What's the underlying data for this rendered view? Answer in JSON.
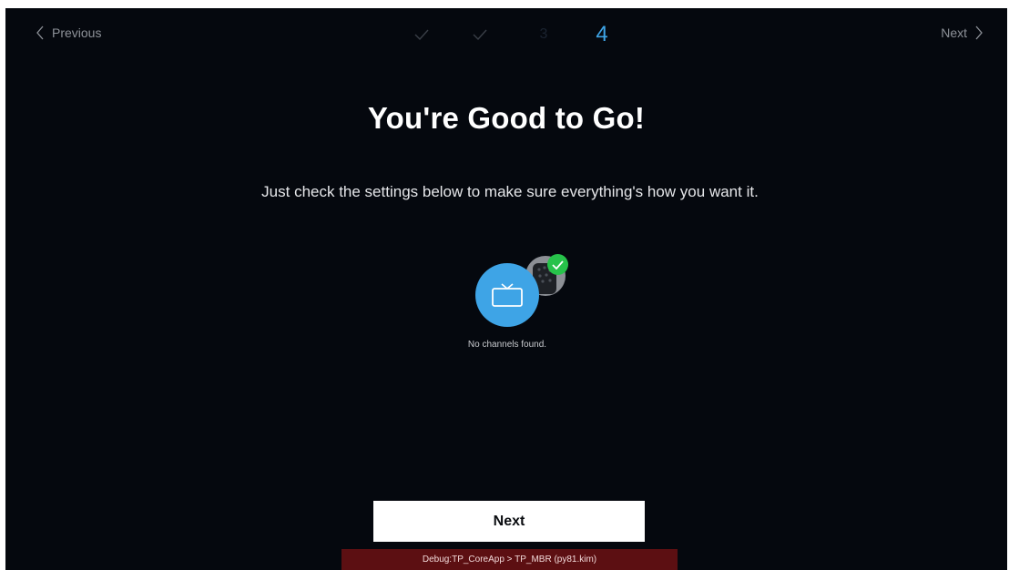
{
  "nav": {
    "previous_label": "Previous",
    "next_label": "Next"
  },
  "stepper": {
    "steps": [
      {
        "state": "completed",
        "label": ""
      },
      {
        "state": "completed",
        "label": ""
      },
      {
        "state": "upcoming",
        "label": "3"
      },
      {
        "state": "current",
        "label": "4"
      }
    ]
  },
  "main": {
    "title": "You're Good to Go!",
    "subtitle": "Just check the settings below to make sure everything's how you want it.",
    "status_text": "No channels found.",
    "icons": [
      "tv-icon",
      "remote-icon",
      "checkmark-icon"
    ]
  },
  "footer": {
    "next_button_label": "Next",
    "debug_text": "Debug:TP_CoreApp > TP_MBR (py81.kim)"
  },
  "colors": {
    "background": "#05080e",
    "accent": "#3ea4e6",
    "success": "#27c24a",
    "debug_bar": "#5c0f12"
  }
}
